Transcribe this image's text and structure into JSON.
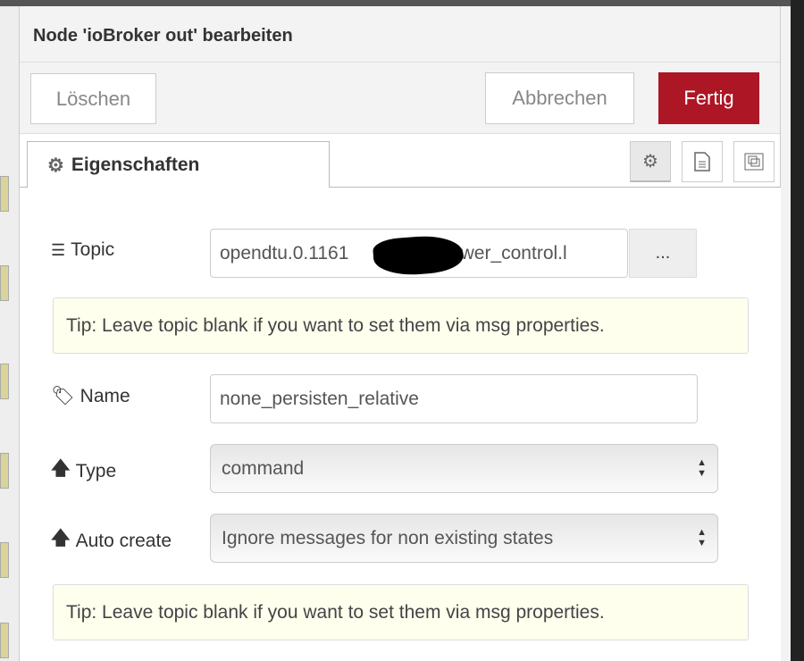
{
  "dialog": {
    "title": "Node 'ioBroker out' bearbeiten"
  },
  "buttons": {
    "delete": "Löschen",
    "cancel": "Abbrechen",
    "done": "Fertig"
  },
  "colors": {
    "primary": "#ad1625",
    "tip_bg": "#ffffee"
  },
  "tabs": {
    "properties": "Eigenschaften",
    "icons": [
      "gear-icon",
      "document-icon",
      "appearance-icon"
    ]
  },
  "form": {
    "topic": {
      "label": "Topic",
      "value_start": "opendtu.0.1161",
      "value_end": ".power_control.l",
      "browse": "..."
    },
    "tip1": "Tip: Leave topic blank if you want to set them via msg properties.",
    "name": {
      "label": "Name",
      "value": "none_persisten_relative"
    },
    "type": {
      "label": "Type",
      "value": "command"
    },
    "autocreate": {
      "label": "Auto create",
      "value": "Ignore messages for non existing states"
    },
    "tip2": "Tip: Leave topic blank if you want to set them via msg properties."
  }
}
